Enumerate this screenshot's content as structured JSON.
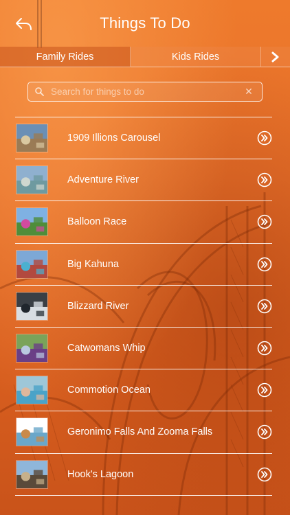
{
  "header": {
    "title": "Things To Do"
  },
  "tabs": [
    {
      "label": "Family Rides"
    },
    {
      "label": "Kids Rides"
    }
  ],
  "search": {
    "placeholder": "Search for things to do",
    "value": ""
  },
  "items": [
    {
      "label": "1909 Illions Carousel",
      "thumb": {
        "sky": "#6b8fb5",
        "main": "#9a7b55",
        "accent": "#d9c8a0"
      }
    },
    {
      "label": "Adventure River",
      "thumb": {
        "sky": "#8fb0cf",
        "main": "#6e9aa0",
        "accent": "#cfd7cf"
      }
    },
    {
      "label": "Balloon Race",
      "thumb": {
        "sky": "#7fb1e3",
        "main": "#4f8d3a",
        "accent": "#d24aa0"
      }
    },
    {
      "label": "Big Kahuna",
      "thumb": {
        "sky": "#7da8d6",
        "main": "#b2493f",
        "accent": "#4bb0d0"
      }
    },
    {
      "label": "Blizzard River",
      "thumb": {
        "sky": "#3a3f45",
        "main": "#d8dde2",
        "accent": "#20262d"
      }
    },
    {
      "label": "Catwomans Whip",
      "thumb": {
        "sky": "#7aa35a",
        "main": "#6a3f86",
        "accent": "#b9c9e0"
      }
    },
    {
      "label": "Commotion Ocean",
      "thumb": {
        "sky": "#9ec7d8",
        "main": "#4aa3c8",
        "accent": "#e0b79c"
      }
    },
    {
      "label": "Geronimo Falls And Zooma Falls",
      "thumb": {
        "sky": "#ffffff",
        "main": "#6aa7c9",
        "accent": "#c98a4a"
      }
    },
    {
      "label": "Hook's Lagoon",
      "thumb": {
        "sky": "#8fb6da",
        "main": "#5a4a3a",
        "accent": "#c7b08a"
      }
    }
  ],
  "icons": {
    "back": "back-arrow-icon",
    "tabs_next": "chevron-right-icon",
    "search": "search-icon",
    "clear": "clear-icon",
    "row_chevron": "double-chevron-circle-icon"
  },
  "colors": {
    "background": "#e56a1f",
    "text": "#ffffff"
  }
}
